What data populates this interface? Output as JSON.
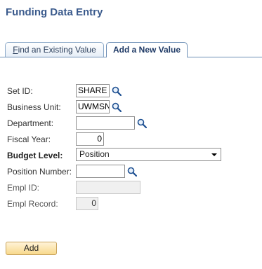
{
  "page": {
    "title": "Funding Data Entry"
  },
  "tabs": [
    {
      "prefix": "F",
      "rest": "ind an Existing Value",
      "active": false
    },
    {
      "label": "Add a New Value",
      "active": true
    }
  ],
  "form": {
    "set_id": {
      "label": "Set ID:",
      "value": "SHARE"
    },
    "business_unit": {
      "label": "Business Unit:",
      "value": "UWMSN"
    },
    "department": {
      "label": "Department:",
      "value": ""
    },
    "fiscal_year": {
      "label": "Fiscal Year:",
      "value": "0"
    },
    "budget_level": {
      "label": "Budget Level:",
      "selected": "Position"
    },
    "position_number": {
      "label": "Position Number:",
      "value": ""
    },
    "empl_id": {
      "label": "Empl ID:",
      "value": ""
    },
    "empl_record": {
      "label": "Empl Record:",
      "value": "0"
    }
  },
  "buttons": {
    "add_label": "Add"
  },
  "icons": {
    "lookup": "magnifier-icon"
  },
  "colors": {
    "title": "#3a5a8c",
    "tab_border": "#6d8fb6",
    "button_fill": "#f8d98c"
  }
}
